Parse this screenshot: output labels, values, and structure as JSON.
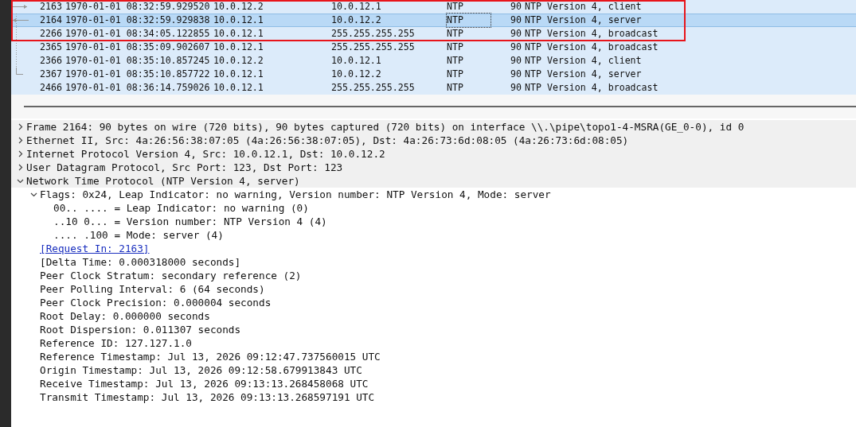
{
  "packet_list": {
    "rows": [
      {
        "no": "2163",
        "time": "1970-01-01 08:32:59.929520",
        "source": "10.0.12.2",
        "destination": "10.0.12.1",
        "protocol": "NTP",
        "length": "90",
        "info": "NTP Version 4, client",
        "selected": false,
        "kind": "request"
      },
      {
        "no": "2164",
        "time": "1970-01-01 08:32:59.929838",
        "source": "10.0.12.1",
        "destination": "10.0.12.2",
        "protocol": "NTP",
        "length": "90",
        "info": "NTP Version 4, server",
        "selected": true,
        "kind": "response"
      },
      {
        "no": "2266",
        "time": "1970-01-01 08:34:05.122855",
        "source": "10.0.12.1",
        "destination": "255.255.255.255",
        "protocol": "NTP",
        "length": "90",
        "info": "NTP Version 4, broadcast",
        "selected": false,
        "kind": "related"
      },
      {
        "no": "2365",
        "time": "1970-01-01 08:35:09.902607",
        "source": "10.0.12.1",
        "destination": "255.255.255.255",
        "protocol": "NTP",
        "length": "90",
        "info": "NTP Version 4, broadcast",
        "selected": false,
        "kind": "related"
      },
      {
        "no": "2366",
        "time": "1970-01-01 08:35:10.857245",
        "source": "10.0.12.2",
        "destination": "10.0.12.1",
        "protocol": "NTP",
        "length": "90",
        "info": "NTP Version 4, client",
        "selected": false,
        "kind": "related"
      },
      {
        "no": "2367",
        "time": "1970-01-01 08:35:10.857722",
        "source": "10.0.12.1",
        "destination": "10.0.12.2",
        "protocol": "NTP",
        "length": "90",
        "info": "NTP Version 4, server",
        "selected": false,
        "kind": "last"
      },
      {
        "no": "2466",
        "time": "1970-01-01 08:36:14.759026",
        "source": "10.0.12.1",
        "destination": "255.255.255.255",
        "protocol": "NTP",
        "length": "90",
        "info": "NTP Version 4, broadcast",
        "selected": false,
        "kind": "none"
      }
    ]
  },
  "details": {
    "items": [
      {
        "text": "Frame 2164: 90 bytes on wire (720 bits), 90 bytes captured (720 bits) on interface \\\\.\\pipe\\topo1-4-MSRA(GE_0-0), id 0",
        "expanded": false
      },
      {
        "text": "Ethernet II, Src: 4a:26:56:38:07:05 (4a:26:56:38:07:05), Dst: 4a:26:73:6d:08:05 (4a:26:73:6d:08:05)",
        "expanded": false
      },
      {
        "text": "Internet Protocol Version 4, Src: 10.0.12.1, Dst: 10.0.12.2",
        "expanded": false
      },
      {
        "text": "User Datagram Protocol, Src Port: 123, Dst Port: 123",
        "expanded": false
      },
      {
        "text": "Network Time Protocol (NTP Version 4, server)",
        "expanded": true,
        "children": [
          {
            "text": "Flags: 0x24, Leap Indicator: no warning, Version number: NTP Version 4, Mode: server",
            "expanded": true,
            "children": [
              {
                "text": "00.. .... = Leap Indicator: no warning (0)"
              },
              {
                "text": "..10 0... = Version number: NTP Version 4 (4)"
              },
              {
                "text": ".... .100 = Mode: server (4)"
              }
            ]
          },
          {
            "text": "[Request In: 2163]",
            "kind": "link"
          },
          {
            "text": "[Delta Time: 0.000318000 seconds]"
          },
          {
            "text": "Peer Clock Stratum: secondary reference (2)"
          },
          {
            "text": "Peer Polling Interval: 6 (64 seconds)"
          },
          {
            "text": "Peer Clock Precision: 0.000004 seconds"
          },
          {
            "text": "Root Delay: 0.000000 seconds"
          },
          {
            "text": "Root Dispersion: 0.011307 seconds"
          },
          {
            "text": "Reference ID: 127.127.1.0"
          },
          {
            "text": "Reference Timestamp: Jul 13, 2026 09:12:47.737560015 UTC"
          },
          {
            "text": "Origin Timestamp: Jul 13, 2026 09:12:58.679913843 UTC"
          },
          {
            "text": "Receive Timestamp: Jul 13, 2026 09:13:13.268458068 UTC"
          },
          {
            "text": "Transmit Timestamp: Jul 13, 2026 09:13:13.268597191 UTC"
          }
        ]
      }
    ]
  }
}
